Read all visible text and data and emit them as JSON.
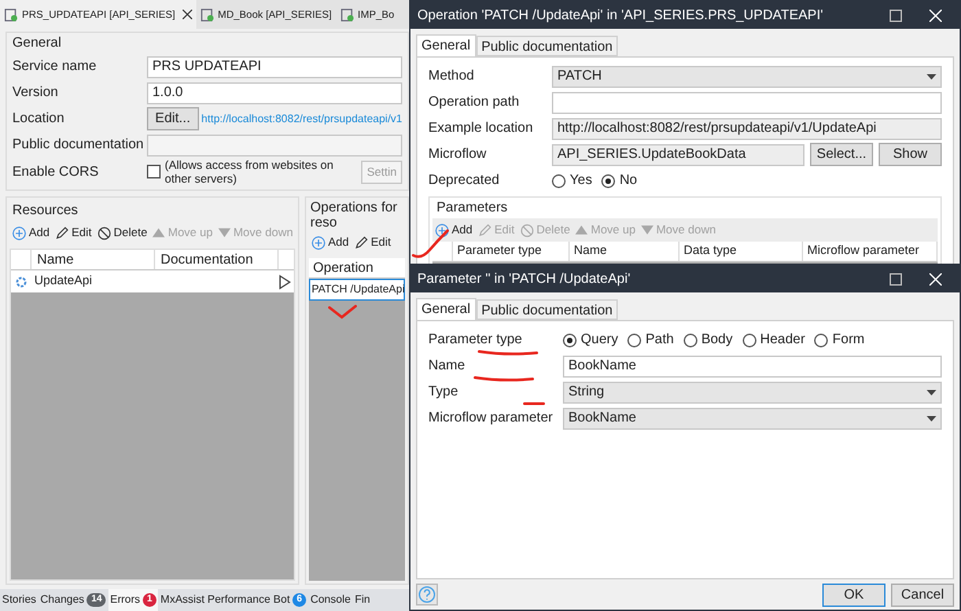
{
  "document_tabs": [
    {
      "label": "PRS_UPDATEAPI [API_SERIES]",
      "selected": true,
      "closable": true
    },
    {
      "label": "MD_Book [API_SERIES]",
      "selected": false,
      "closable": false
    },
    {
      "label": "IMP_Bo",
      "selected": false,
      "closable": false
    }
  ],
  "general": {
    "title": "General",
    "fields": [
      {
        "kind": "text",
        "label": "Service name",
        "value": "PRS UPDATEAPI"
      },
      {
        "kind": "text",
        "label": "Version",
        "value": "1.0.0"
      },
      {
        "kind": "link",
        "label": "Location",
        "button": "Edit...",
        "link": "http://localhost:8082/rest/prsupdateapi/v1"
      },
      {
        "kind": "text",
        "label": "Public documentation"
      },
      {
        "kind": "checkbox",
        "label": "Enable CORS",
        "checked": false,
        "text": "(Allows access from websites on other servers)",
        "button": "Settin"
      }
    ]
  },
  "resources": {
    "title": "Resources",
    "toolbar": [
      {
        "label": "Add",
        "kind": "add",
        "disabled": false
      },
      {
        "label": "Edit",
        "kind": "edit",
        "disabled": false
      },
      {
        "label": "Delete",
        "kind": "delete",
        "disabled": false
      },
      {
        "label": "Move up",
        "kind": "up",
        "disabled": true
      },
      {
        "label": "Move down",
        "kind": "down",
        "disabled": true
      }
    ],
    "columns": [
      "Name",
      "Documentation"
    ],
    "rows": [
      {
        "name": "UpdateApi",
        "selected": false
      }
    ]
  },
  "operations": {
    "title": "Operations for reso",
    "toolbar": [
      {
        "label": "Add",
        "kind": "add",
        "disabled": false
      },
      {
        "label": "Edit",
        "kind": "edit",
        "disabled": false
      }
    ],
    "columns": [
      "Operation"
    ],
    "rows": [
      {
        "operation": "PATCH /UpdateApi",
        "selected": true
      }
    ]
  },
  "bottom_tabs": [
    {
      "label": "Stories",
      "selected": false
    },
    {
      "label": "Changes",
      "selected": false,
      "badge": "14",
      "color": "#5f6368"
    },
    {
      "label": "Errors",
      "selected": true,
      "badge": "1",
      "color": "#d9253f"
    },
    {
      "label": "MxAssist Performance Bot",
      "selected": false,
      "badge": "6",
      "color": "#1e88e5"
    },
    {
      "label": "Console",
      "selected": false
    },
    {
      "label": "Fin",
      "selected": false
    }
  ],
  "operation_dialog": {
    "title": "Operation 'PATCH /UpdateApi' in 'API_SERIES.PRS_UPDATEAPI'",
    "tabs": [
      {
        "label": "General",
        "selected": true
      },
      {
        "label": "Public documentation",
        "selected": false
      }
    ],
    "fields": [
      {
        "kind": "dropdown",
        "label": "Method",
        "value": "PATCH"
      },
      {
        "kind": "input",
        "label": "Operation path"
      },
      {
        "kind": "readonly",
        "label": "Example location",
        "value": "http://localhost:8082/rest/prsupdateapi/v1/UpdateApi"
      },
      {
        "kind": "microflow",
        "label": "Microflow",
        "value": "API_SERIES.UpdateBookData",
        "buttons": [
          "Select...",
          "Show"
        ]
      },
      {
        "kind": "radio",
        "label": "Deprecated",
        "options": [
          {
            "label": "Yes",
            "selected": false
          },
          {
            "label": "No",
            "selected": true
          }
        ]
      }
    ],
    "parameters": {
      "title": "Parameters",
      "toolbar": [
        {
          "label": "Add",
          "kind": "add",
          "disabled": false
        },
        {
          "label": "Edit",
          "kind": "edit",
          "disabled": true
        },
        {
          "label": "Delete",
          "kind": "delete",
          "disabled": true
        },
        {
          "label": "Move up",
          "kind": "up",
          "disabled": true
        },
        {
          "label": "Move down",
          "kind": "down",
          "disabled": true
        }
      ],
      "columns": [
        "Parameter type",
        "Name",
        "Data type",
        "Microflow parameter"
      ]
    }
  },
  "parameter_dialog": {
    "title": "Parameter '' in 'PATCH /UpdateApi'",
    "tabs": [
      {
        "label": "General",
        "selected": true
      },
      {
        "label": "Public documentation",
        "selected": false
      }
    ],
    "fields": [
      {
        "kind": "radio",
        "label": "Parameter type",
        "options": [
          {
            "label": "Query",
            "selected": true
          },
          {
            "label": "Path",
            "selected": false
          },
          {
            "label": "Body",
            "selected": false
          },
          {
            "label": "Header",
            "selected": false
          },
          {
            "label": "Form",
            "selected": false
          }
        ]
      },
      {
        "kind": "input",
        "label": "Name",
        "value": "BookName"
      },
      {
        "kind": "dropdown",
        "label": "Type",
        "value": "String"
      },
      {
        "kind": "dropdown",
        "label": "Microflow parameter",
        "value": "BookName"
      }
    ],
    "buttons": [
      {
        "label": "OK",
        "default": true
      },
      {
        "label": "Cancel",
        "default": false
      }
    ]
  }
}
